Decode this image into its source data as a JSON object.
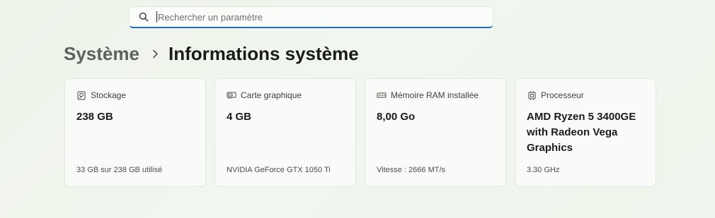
{
  "search": {
    "placeholder": "Rechercher un paramètre",
    "icon": "search-icon"
  },
  "breadcrumb": {
    "parent": "Système",
    "current": "Informations système"
  },
  "cards": [
    {
      "icon": "storage-icon",
      "title": "Stockage",
      "value": "238 GB",
      "detail": "33 GB sur 238 GB utilisé"
    },
    {
      "icon": "graphics-card-icon",
      "title": "Carte graphique",
      "value": "4 GB",
      "detail": "NVIDIA GeForce GTX 1050 Ti"
    },
    {
      "icon": "ram-icon",
      "title": "Mémoire RAM installée",
      "value": "8,00 Go",
      "detail": "Vitesse : 2666 MT/s"
    },
    {
      "icon": "processor-icon",
      "title": "Processeur",
      "value": "AMD Ryzen 5 3400GE with Radeon Vega Graphics",
      "detail": "3.30 GHz"
    }
  ],
  "colors": {
    "accent": "#1f6cc4",
    "background": "#eef3ea"
  }
}
